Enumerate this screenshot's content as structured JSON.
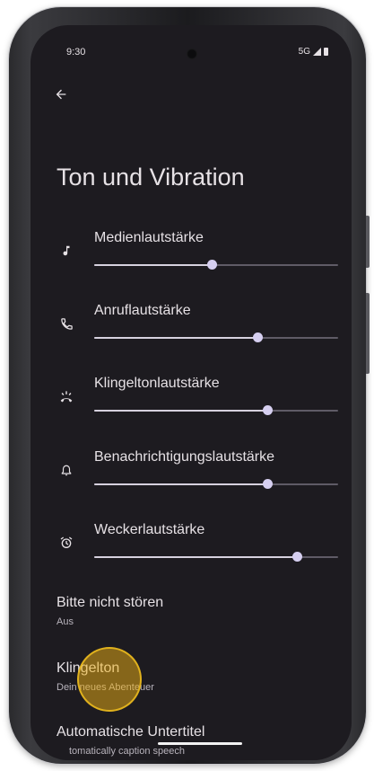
{
  "status_bar": {
    "time": "9:30",
    "network": "5G",
    "signal_icon": "signal-icon",
    "battery_icon": "battery-icon"
  },
  "toolbar": {
    "back_icon": "arrow-back-icon"
  },
  "page": {
    "title": "Ton und Vibration"
  },
  "sliders": [
    {
      "label": "Medienlautstärke",
      "icon": "music-note-icon",
      "value": 0.48
    },
    {
      "label": "Anruflautstärke",
      "icon": "phone-icon",
      "value": 0.67
    },
    {
      "label": "Klingeltonlautstärke",
      "icon": "ring-volume-icon",
      "value": 0.71
    },
    {
      "label": "Benachrichtigungslautstärke",
      "icon": "bell-icon",
      "value": 0.71
    },
    {
      "label": "Weckerlautstärke",
      "icon": "alarm-icon",
      "value": 0.83
    }
  ],
  "preferences": {
    "dnd": {
      "title": "Bitte nicht stören",
      "summary": "Aus"
    },
    "ringtone": {
      "title": "Klingelton",
      "summary": "Dein neues Abenteuer"
    },
    "captions": {
      "title": "Automatische Untertitel",
      "summary": "tomatically caption speech"
    }
  },
  "colors": {
    "background": "#1d1b20",
    "text": "#e6e1e5",
    "slider_active": "#d6d1de",
    "slider_thumb": "#d6cff0",
    "touch_indicator": "#f0b214"
  }
}
